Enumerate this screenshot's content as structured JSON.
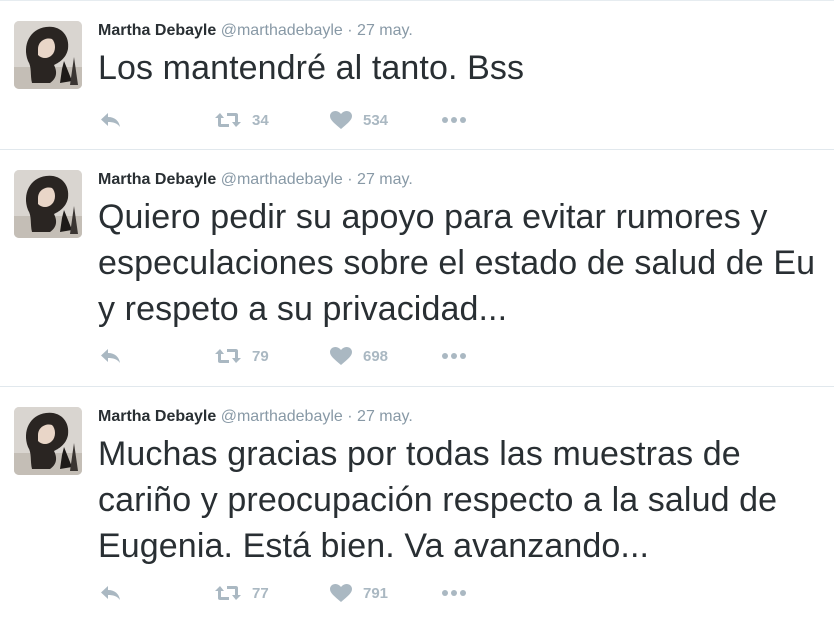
{
  "tweets": [
    {
      "author": {
        "name": "Martha Debayle",
        "handle": "@marthadebayle"
      },
      "separator": "·",
      "date": "27 may.",
      "text": "Los mantendré al tanto. Bss",
      "retweets": "34",
      "likes": "534"
    },
    {
      "author": {
        "name": "Martha Debayle",
        "handle": "@marthadebayle"
      },
      "separator": "·",
      "date": "27 may.",
      "text": "Quiero pedir su apoyo para evitar rumores y especulaciones sobre el estado de salud de Eu y respeto a su privacidad...",
      "retweets": "79",
      "likes": "698"
    },
    {
      "author": {
        "name": "Martha Debayle",
        "handle": "@marthadebayle"
      },
      "separator": "·",
      "date": "27 may.",
      "text": "Muchas gracias por todas las muestras de cariño y preocupación respecto a la salud de Eugenia. Está bien. Va avanzando...",
      "retweets": "77",
      "likes": "791"
    }
  ],
  "icons": {
    "reply": "reply-icon",
    "retweet": "retweet-icon",
    "like": "heart-icon",
    "more": "more-dots-icon"
  },
  "colors": {
    "text": "#292f33",
    "meta": "#8899a6",
    "action": "#aab8c2",
    "divider": "#e1e8ed"
  }
}
